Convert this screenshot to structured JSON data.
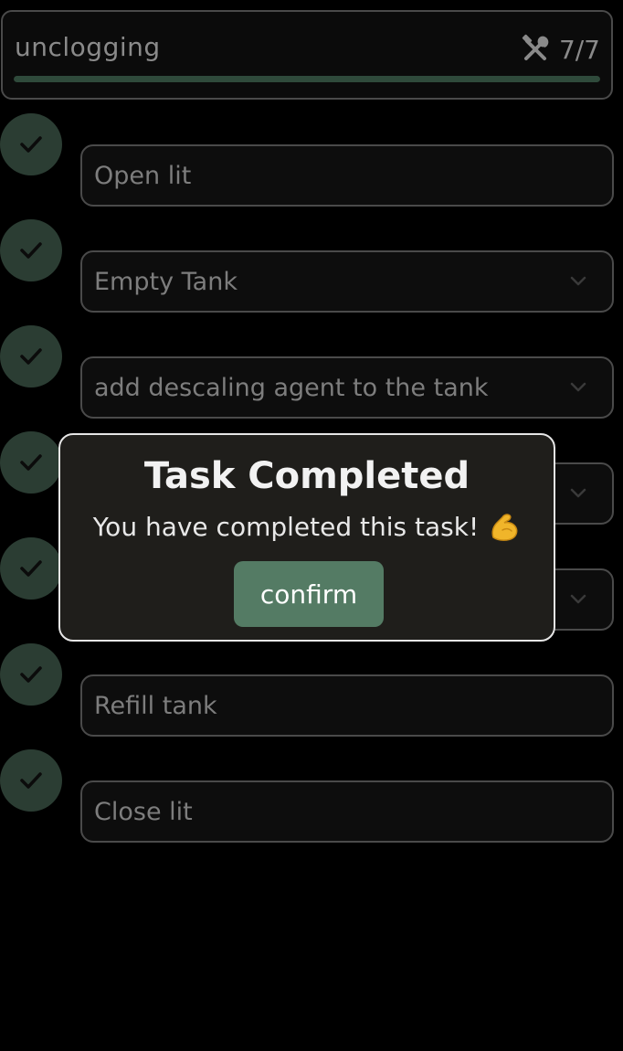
{
  "header": {
    "title": "unclogging",
    "count": "7/7",
    "progress": 1.0,
    "icon": "tools-icon"
  },
  "steps": [
    {
      "label": "Open lit",
      "completed": true,
      "has_dropdown": false
    },
    {
      "label": "Empty Tank",
      "completed": true,
      "has_dropdown": true
    },
    {
      "label": "add descaling agent to the tank",
      "completed": true,
      "has_dropdown": true
    },
    {
      "label": "",
      "completed": true,
      "has_dropdown": true
    },
    {
      "label": "",
      "completed": true,
      "has_dropdown": true
    },
    {
      "label": "Refill tank",
      "completed": true,
      "has_dropdown": false
    },
    {
      "label": "Close lit",
      "completed": true,
      "has_dropdown": false
    }
  ],
  "modal": {
    "title": "Task Completed",
    "message": "You have completed this task!",
    "emoji": "flexed-biceps-icon",
    "confirm_label": "confirm"
  },
  "colors": {
    "background": "#000000",
    "check_circle": "#2b3d33",
    "progress_fill": "#2f4a3b",
    "confirm_button": "#547b64",
    "modal_bg": "#1f1e1b"
  }
}
